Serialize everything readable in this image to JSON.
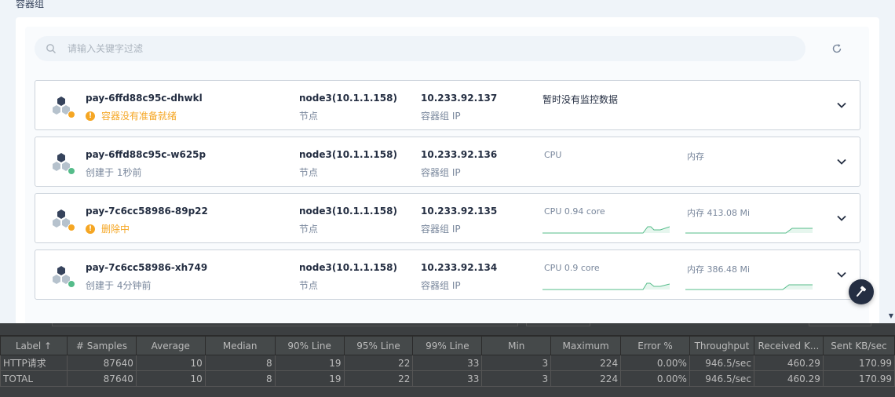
{
  "page": {
    "title": "容器组"
  },
  "search": {
    "placeholder": "请输入关键字过滤"
  },
  "pods": [
    {
      "name": "pay-6ffd88c95c-dhwkl",
      "status": "容器没有准备就绪",
      "status_type": "warning",
      "node": "node3(10.1.1.158)",
      "node_label": "节点",
      "ip": "10.233.92.137",
      "ip_label": "容器组 IP",
      "monitoring": "暂时没有监控数据"
    },
    {
      "name": "pay-6ffd88c95c-w625p",
      "status": "创建于 1秒前",
      "status_type": "ok",
      "node": "node3(10.1.1.158)",
      "node_label": "节点",
      "ip": "10.233.92.136",
      "ip_label": "容器组 IP",
      "cpu_label": "CPU",
      "mem_label": "内存"
    },
    {
      "name": "pay-7c6cc58986-89p22",
      "status": "删除中",
      "status_type": "warning",
      "node": "node3(10.1.1.158)",
      "node_label": "节点",
      "ip": "10.233.92.135",
      "ip_label": "容器组 IP",
      "cpu_label": "CPU 0.94 core",
      "mem_label": "内存 413.08 Mi"
    },
    {
      "name": "pay-7c6cc58986-xh749",
      "status": "创建于 4分钟前",
      "status_type": "ok",
      "node": "node3(10.1.1.158)",
      "node_label": "节点",
      "ip": "10.233.92.134",
      "ip_label": "容器组 IP",
      "cpu_label": "CPU 0.9 core",
      "mem_label": "内存 386.48 Mi"
    }
  ],
  "colors": {
    "warning": "#f5a623",
    "ok": "#55bc8a",
    "spark": "#55bc8a",
    "jmeter_bg": "#3c3f41"
  },
  "icons": {
    "search": "search-icon",
    "refresh": "refresh-icon",
    "pod": "pod-icon",
    "expand": "chevron-down-icon",
    "fab": "hammer-icon"
  },
  "jmeter": {
    "columns": [
      "Label ↑",
      "# Samples",
      "Average",
      "Median",
      "90% Line",
      "95% Line",
      "99% Line",
      "Min",
      "Maximum",
      "Error %",
      "Throughput",
      "Received K...",
      "Sent KB/sec"
    ],
    "rows": [
      [
        "HTTP请求",
        "87640",
        "10",
        "8",
        "19",
        "22",
        "33",
        "3",
        "224",
        "0.00%",
        "946.5/sec",
        "460.29",
        "170.99"
      ],
      [
        "TOTAL",
        "87640",
        "10",
        "8",
        "19",
        "22",
        "33",
        "3",
        "224",
        "0.00%",
        "946.5/sec",
        "460.29",
        "170.99"
      ]
    ]
  }
}
